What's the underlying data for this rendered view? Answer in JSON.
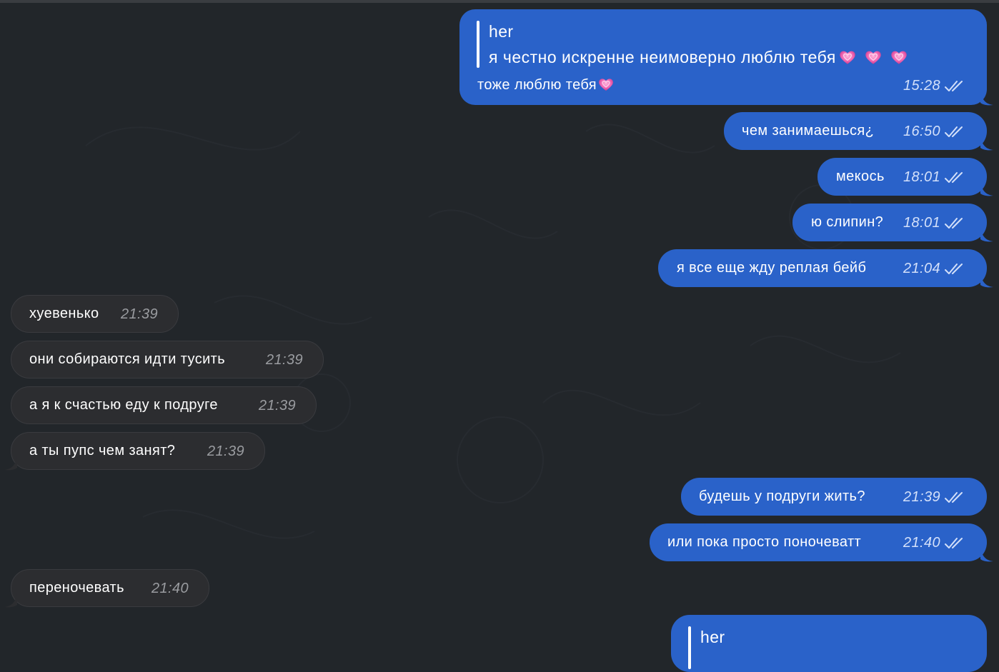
{
  "colors": {
    "background": "#22262a",
    "outgoing_bubble": "#2a62c9",
    "incoming_bubble": "#2c2d30"
  },
  "messages": [
    {
      "direction": "out",
      "reply": {
        "name": "her",
        "text": "я честно искренне неимоверно люблю тебя"
      },
      "text": "тоже люблю тебя",
      "time": "15:28",
      "status_icon": "double-check-icon"
    },
    {
      "direction": "out",
      "text": "чем занимаешься¿",
      "time": "16:50",
      "status_icon": "double-check-icon"
    },
    {
      "direction": "out",
      "text": "мекось",
      "time": "18:01",
      "status_icon": "double-check-icon"
    },
    {
      "direction": "out",
      "text": "ю слипин?",
      "time": "18:01",
      "status_icon": "double-check-icon"
    },
    {
      "direction": "out",
      "text": "я все еще жду реплая бейб",
      "time": "21:04",
      "status_icon": "double-check-icon"
    },
    {
      "direction": "in",
      "text": "хуевенько",
      "time": "21:39"
    },
    {
      "direction": "in",
      "text": "они собираются идти тусить",
      "time": "21:39"
    },
    {
      "direction": "in",
      "text": "а я к счастью еду к подруге",
      "time": "21:39"
    },
    {
      "direction": "in",
      "text": "а ты пупс чем занят?",
      "time": "21:39"
    },
    {
      "direction": "out",
      "text": "будешь у подруги жить?",
      "time": "21:39",
      "status_icon": "double-check-icon"
    },
    {
      "direction": "out",
      "text": "или пока просто поночеватт",
      "time": "21:40",
      "status_icon": "double-check-icon"
    },
    {
      "direction": "in",
      "text": "переночевать",
      "time": "21:40"
    },
    {
      "direction": "out",
      "reply": {
        "name": "her"
      }
    }
  ]
}
